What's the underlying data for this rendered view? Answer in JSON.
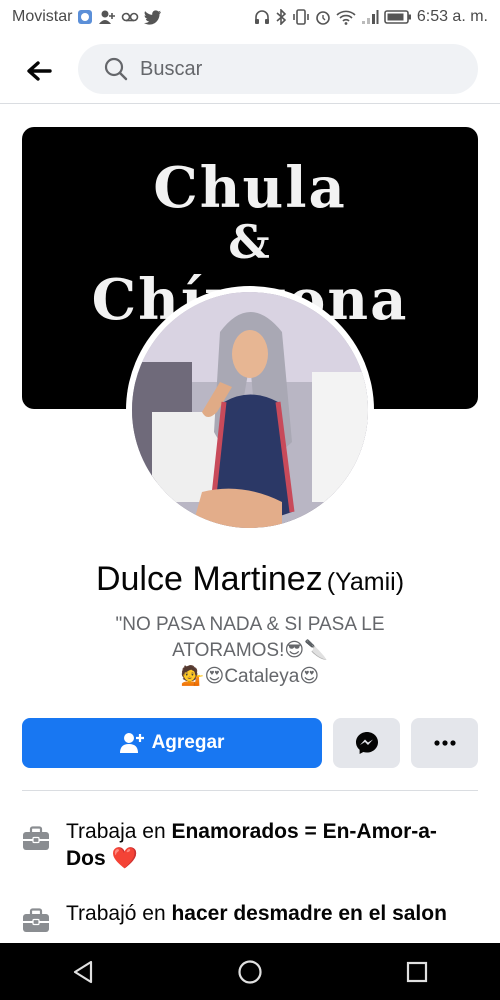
{
  "status_bar": {
    "carrier": "Movistar",
    "time": "6:53 a. m."
  },
  "search": {
    "placeholder": "Buscar"
  },
  "cover": {
    "line1": "Chula",
    "line2": "&",
    "line3": "Chíngona"
  },
  "profile": {
    "name": "Dulce Martinez",
    "alternate_name": "(Yamii)",
    "bio_line1": "\"NO PASA NADA & SI PASA LE",
    "bio_line2": "ATORAMOS!😎🔪",
    "bio_line3": "💁😍Cataleya😍"
  },
  "actions": {
    "add_friend_label": "Agregar"
  },
  "details": [
    {
      "prefix": "Trabaja en ",
      "bold": "Enamorados = En-Amor-a-Dos",
      "suffix": " ❤️"
    },
    {
      "prefix": "Trabajó en ",
      "bold": "hacer desmadre en el salon",
      "suffix": ""
    }
  ],
  "colors": {
    "primary": "#1877f2",
    "secondary_button": "#e4e6eb",
    "search_bg": "#f0f2f5",
    "muted_text": "#65676b"
  }
}
